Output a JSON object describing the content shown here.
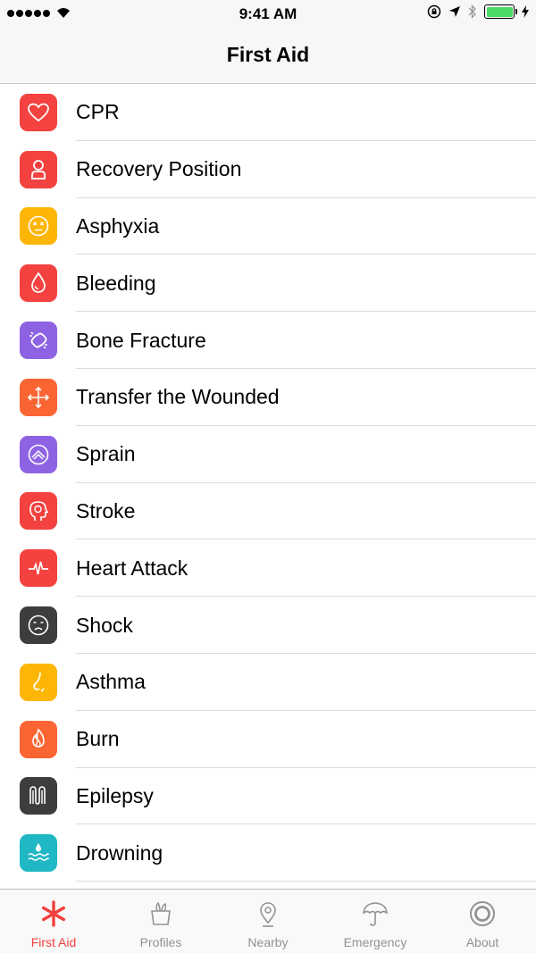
{
  "status_bar": {
    "time": "9:41 AM"
  },
  "nav": {
    "title": "First Aid"
  },
  "items": [
    {
      "label": "CPR",
      "icon": "heart-icon",
      "color": "#f3423f"
    },
    {
      "label": "Recovery Position",
      "icon": "person-icon",
      "color": "#f3423f"
    },
    {
      "label": "Asphyxia",
      "icon": "dizzy-face-icon",
      "color": "#fdb606"
    },
    {
      "label": "Bleeding",
      "icon": "blood-drop-icon",
      "color": "#f3423f"
    },
    {
      "label": "Bone Fracture",
      "icon": "broken-link-icon",
      "color": "#8e63e3"
    },
    {
      "label": "Transfer the Wounded",
      "icon": "move-arrows-icon",
      "color": "#fb6533"
    },
    {
      "label": "Sprain",
      "icon": "sprain-icon",
      "color": "#8e63e3"
    },
    {
      "label": "Stroke",
      "icon": "head-icon",
      "color": "#f3423f"
    },
    {
      "label": "Heart Attack",
      "icon": "pulse-icon",
      "color": "#f3423f"
    },
    {
      "label": "Shock",
      "icon": "sad-face-icon",
      "color": "#3d3d3d"
    },
    {
      "label": "Asthma",
      "icon": "nose-icon",
      "color": "#fdb606"
    },
    {
      "label": "Burn",
      "icon": "flame-icon",
      "color": "#fb6533"
    },
    {
      "label": "Epilepsy",
      "icon": "wave-icon",
      "color": "#3d3d3d"
    },
    {
      "label": "Drowning",
      "icon": "water-icon",
      "color": "#20b8c4"
    }
  ],
  "tabs": [
    {
      "label": "First Aid",
      "icon": "asterisk-icon",
      "active": true
    },
    {
      "label": "Profiles",
      "icon": "profiles-icon",
      "active": false
    },
    {
      "label": "Nearby",
      "icon": "location-pin-icon",
      "active": false
    },
    {
      "label": "Emergency",
      "icon": "umbrella-icon",
      "active": false
    },
    {
      "label": "About",
      "icon": "target-icon",
      "active": false
    }
  ],
  "colors": {
    "accent": "#f2403e",
    "inactive": "#929292",
    "battery": "#4cd964"
  }
}
